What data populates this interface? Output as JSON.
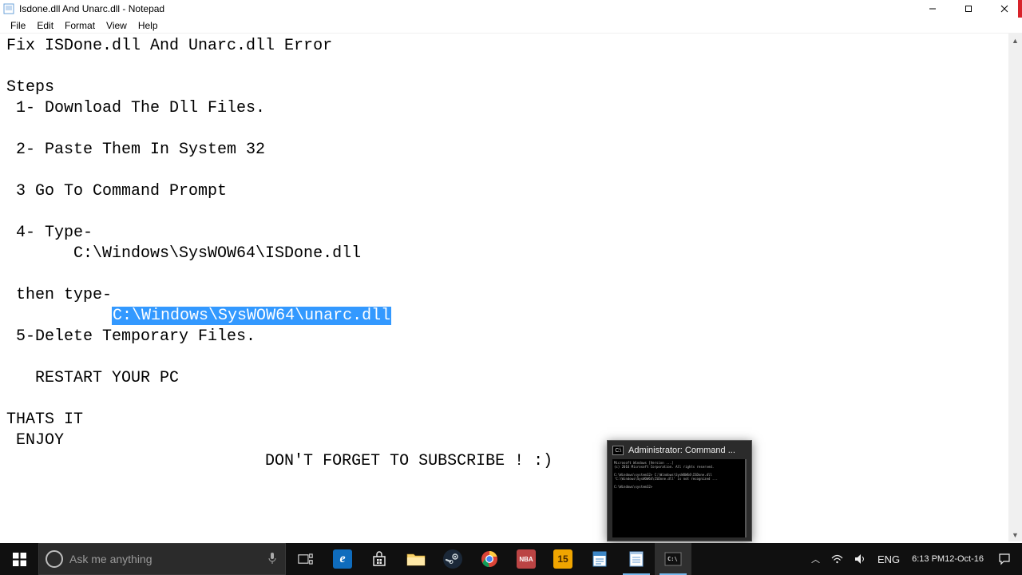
{
  "window": {
    "title": "Isdone.dll And Unarc.dll - Notepad",
    "app_icon": "notepad-icon"
  },
  "menubar": {
    "items": [
      "File",
      "Edit",
      "Format",
      "View",
      "Help"
    ]
  },
  "document": {
    "lines": [
      "Fix ISDone.dll And Unarc.dll Error",
      "",
      "Steps",
      " 1- Download The Dll Files.",
      "",
      " 2- Paste Them In System 32",
      "",
      " 3 Go To Command Prompt",
      "",
      " 4- Type-",
      "       C:\\Windows\\SysWOW64\\ISDone.dll",
      "",
      " then type-",
      "",
      " 5-Delete Temporary Files.",
      "",
      "   RESTART YOUR PC",
      "",
      "THATS IT",
      " ENJOY",
      "                           DON'T FORGET TO SUBSCRIBE ! :)"
    ],
    "selection_line_index": 13,
    "selection_prefix": "           ",
    "selection_text": "C:\\Windows\\SysWOW64\\unarc.dll"
  },
  "thumbnail": {
    "title": "Administrator: Command ...",
    "body_lines": "Microsoft Windows [Version ...]\n(c) 2016 Microsoft Corporation. All rights reserved.\n\nC:\\Windows\\system32> C:\\Windows\\SysWOW64\\ISDone.dll\n'C:\\Windows\\SysWOW64\\ISDone.dll' is not recognized ...\n\nC:\\Windows\\system32>"
  },
  "taskbar": {
    "search_placeholder": "Ask me anything",
    "apps": [
      {
        "name": "edge",
        "label": "e",
        "bg": "#0f6cbd",
        "active": false
      },
      {
        "name": "store",
        "label": "",
        "bg": "transparent",
        "active": false
      },
      {
        "name": "file-explorer",
        "label": "",
        "bg": "#f8d36b",
        "active": false
      },
      {
        "name": "steam",
        "label": "",
        "bg": "#1b2838",
        "active": false
      },
      {
        "name": "chrome",
        "label": "",
        "bg": "transparent",
        "active": false
      },
      {
        "name": "nba",
        "label": "NBA",
        "bg": "#b44",
        "active": false
      },
      {
        "name": "fifteen",
        "label": "15",
        "bg": "#f0a500",
        "active": false
      },
      {
        "name": "wordpad",
        "label": "",
        "bg": "#3c87c7",
        "active": false
      },
      {
        "name": "notepad",
        "label": "",
        "bg": "transparent",
        "active": true
      },
      {
        "name": "cmd",
        "label": "",
        "bg": "#111",
        "active": true
      }
    ],
    "tray": {
      "lang": "ENG",
      "time": "6:13 PM",
      "date": "12-Oct-16"
    }
  }
}
